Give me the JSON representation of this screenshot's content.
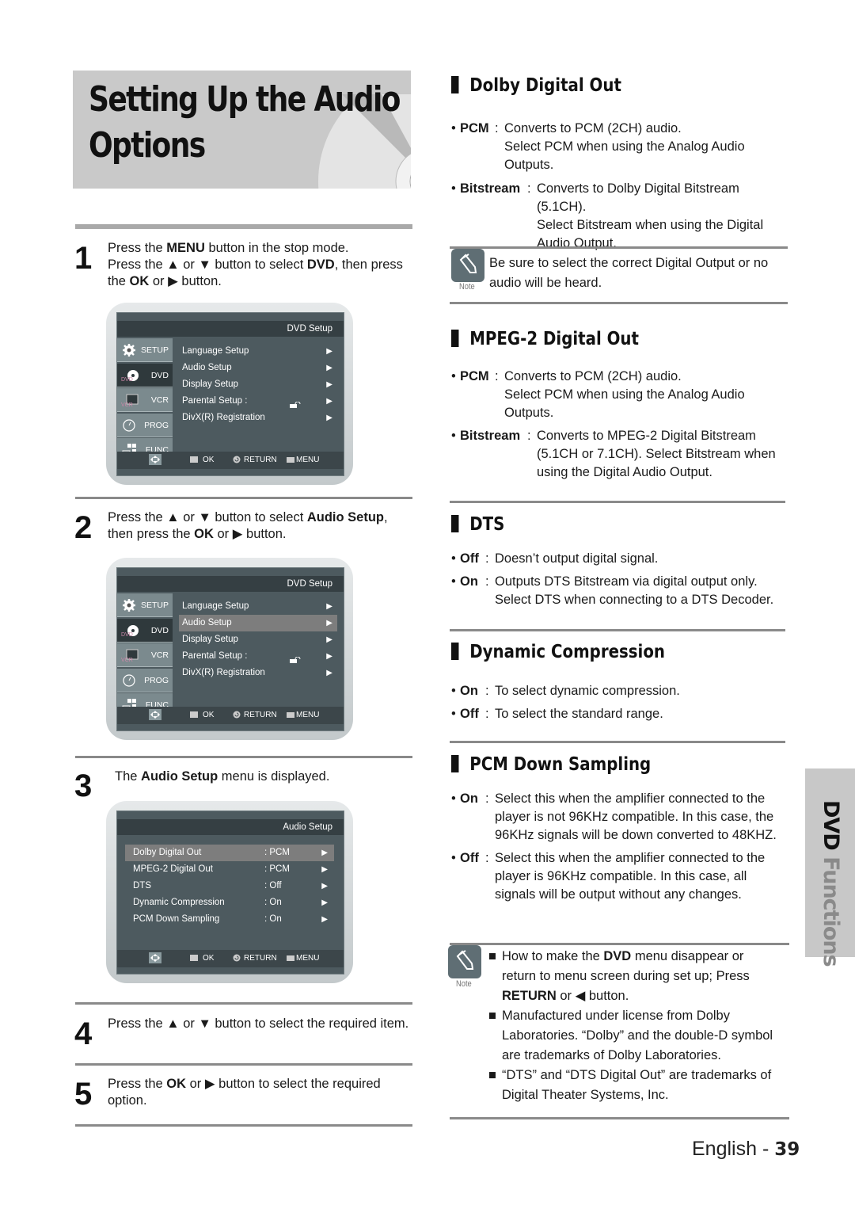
{
  "page": {
    "title_line1": "Setting Up the Audio",
    "title_line2": "Options",
    "side_tab_bold": "DVD ",
    "side_tab_light": "Functions",
    "footer_lang": "English - ",
    "footer_page": "39"
  },
  "steps": [
    {
      "num": "1",
      "parts": [
        {
          "t": "Press the "
        },
        {
          "b": "MENU"
        },
        {
          "t": " button in the stop mode."
        },
        {
          "br": true
        },
        {
          "t": "Press the ▲ or ▼ button to select "
        },
        {
          "b": "DVD"
        },
        {
          "t": ", then press"
        },
        {
          "br": true
        },
        {
          "t": "the "
        },
        {
          "b": "OK"
        },
        {
          "t": " or ▶ button."
        }
      ]
    },
    {
      "num": "2",
      "parts": [
        {
          "t": "Press the ▲ or ▼ button to select "
        },
        {
          "b": "Audio Setup"
        },
        {
          "t": ","
        },
        {
          "br": true
        },
        {
          "t": "then press the "
        },
        {
          "b": "OK"
        },
        {
          "t": " or ▶ button."
        }
      ]
    },
    {
      "num": "3",
      "parts": [
        {
          "t": "The "
        },
        {
          "b": "Audio Setup"
        },
        {
          "t": " menu is displayed."
        }
      ]
    },
    {
      "num": "4",
      "parts": [
        {
          "t": "Press the ▲ or ▼ button to select the required item."
        }
      ]
    },
    {
      "num": "5",
      "parts": [
        {
          "t": "Press the "
        },
        {
          "b": "OK"
        },
        {
          "t": " or ▶ button to select the required"
        },
        {
          "br": true
        },
        {
          "t": "option."
        }
      ]
    }
  ],
  "osd_dvd_setup": {
    "header": "DVD  Setup",
    "tabs": [
      {
        "label": "SETUP",
        "icon": "gear-icon"
      },
      {
        "label": "DVD",
        "icon": "dvd-disc-icon"
      },
      {
        "label": "VCR",
        "icon": "vcr-icon"
      },
      {
        "label": "PROG",
        "icon": "clock-icon"
      },
      {
        "label": "FUNC",
        "icon": "hand-grid-icon"
      }
    ],
    "items": [
      "Language Setup",
      "Audio Setup",
      "Display Setup",
      "Parental Setup :",
      "DivX(R) Registration"
    ],
    "footer": {
      "ok": "OK",
      "return": "RETURN",
      "menu": "MENU"
    }
  },
  "osd_screen1": {
    "active_tab": "DVD",
    "selected_item": null
  },
  "osd_screen2": {
    "active_tab": "DVD",
    "selected_item": "Audio Setup"
  },
  "osd_audio_setup": {
    "header": "Audio Setup",
    "items": [
      {
        "label": "Dolby Digital Out",
        "value": ": PCM"
      },
      {
        "label": "MPEG-2 Digital Out",
        "value": ": PCM"
      },
      {
        "label": "DTS",
        "value": ": Off"
      },
      {
        "label": "Dynamic Compression",
        "value": ": On"
      },
      {
        "label": "PCM Down Sampling",
        "value": ": On"
      }
    ],
    "selected_item": "Dolby Digital Out",
    "footer": {
      "ok": "OK",
      "return": "RETURN",
      "menu": "MENU"
    }
  },
  "sections": {
    "dolby": {
      "title": "Dolby Digital Out",
      "defs": [
        {
          "term": "PCM",
          "desc": "Converts to PCM (2CH) audio.\nSelect PCM when using the Analog Audio\nOutputs."
        },
        {
          "term": "Bitstream",
          "desc": "Converts to Dolby Digital Bitstream (5.1CH).\nSelect Bitstream when using the Digital\nAudio Output."
        }
      ],
      "note_label": "Note",
      "note": "Be sure to select the correct Digital Output or no\naudio will be heard."
    },
    "mpeg": {
      "title": "MPEG-2 Digital Out",
      "defs": [
        {
          "term": "PCM",
          "desc": "Converts to PCM (2CH) audio.\nSelect PCM when using the Analog  Audio\nOutputs."
        },
        {
          "term": "Bitstream",
          "desc": "Converts to MPEG-2 Digital Bitstream\n(5.1CH or 7.1CH). Select Bitstream when\nusing the Digital Audio Output."
        }
      ]
    },
    "dts": {
      "title": "DTS",
      "defs": [
        {
          "term": "Off",
          "desc": "Doesn’t output digital signal."
        },
        {
          "term": "On",
          "desc": "Outputs DTS Bitstream via digital output only.\nSelect DTS when connecting to a DTS Decoder."
        }
      ]
    },
    "dyn": {
      "title": "Dynamic Compression",
      "defs": [
        {
          "term": "On",
          "desc": "To select dynamic compression."
        },
        {
          "term": "Off",
          "desc": "To select the standard range."
        }
      ]
    },
    "pcm": {
      "title": "PCM Down Sampling",
      "defs": [
        {
          "term": "On",
          "desc": "Select this when the amplifier connected to the\nplayer is not 96KHz compatible. In this case, the\n96KHz signals will be down converted to 48KHZ."
        },
        {
          "term": "Off",
          "desc": "Select this when the amplifier connected to the\nplayer is 96KHz compatible. In this case, all\nsignals will be output without any changes."
        }
      ]
    }
  },
  "bottom_note": {
    "label": "Note",
    "items": [
      [
        {
          "t": "How to make the "
        },
        {
          "b": "DVD"
        },
        {
          "t": " menu disappear or"
        },
        {
          "br": true
        },
        {
          "t": "return to menu screen during set up; Press"
        },
        {
          "br": true
        },
        {
          "b": "RETURN"
        },
        {
          "t": " or ◀ button."
        }
      ],
      [
        {
          "t": "Manufactured under license from Dolby"
        },
        {
          "br": true
        },
        {
          "t": "Laboratories. “Dolby” and the double-D symbol"
        },
        {
          "br": true
        },
        {
          "t": "are trademarks of Dolby Laboratories."
        }
      ],
      [
        {
          "t": "“DTS” and “DTS Digital Out” are trademarks of"
        },
        {
          "br": true
        },
        {
          "t": "Digital Theater Systems, Inc."
        }
      ]
    ]
  }
}
